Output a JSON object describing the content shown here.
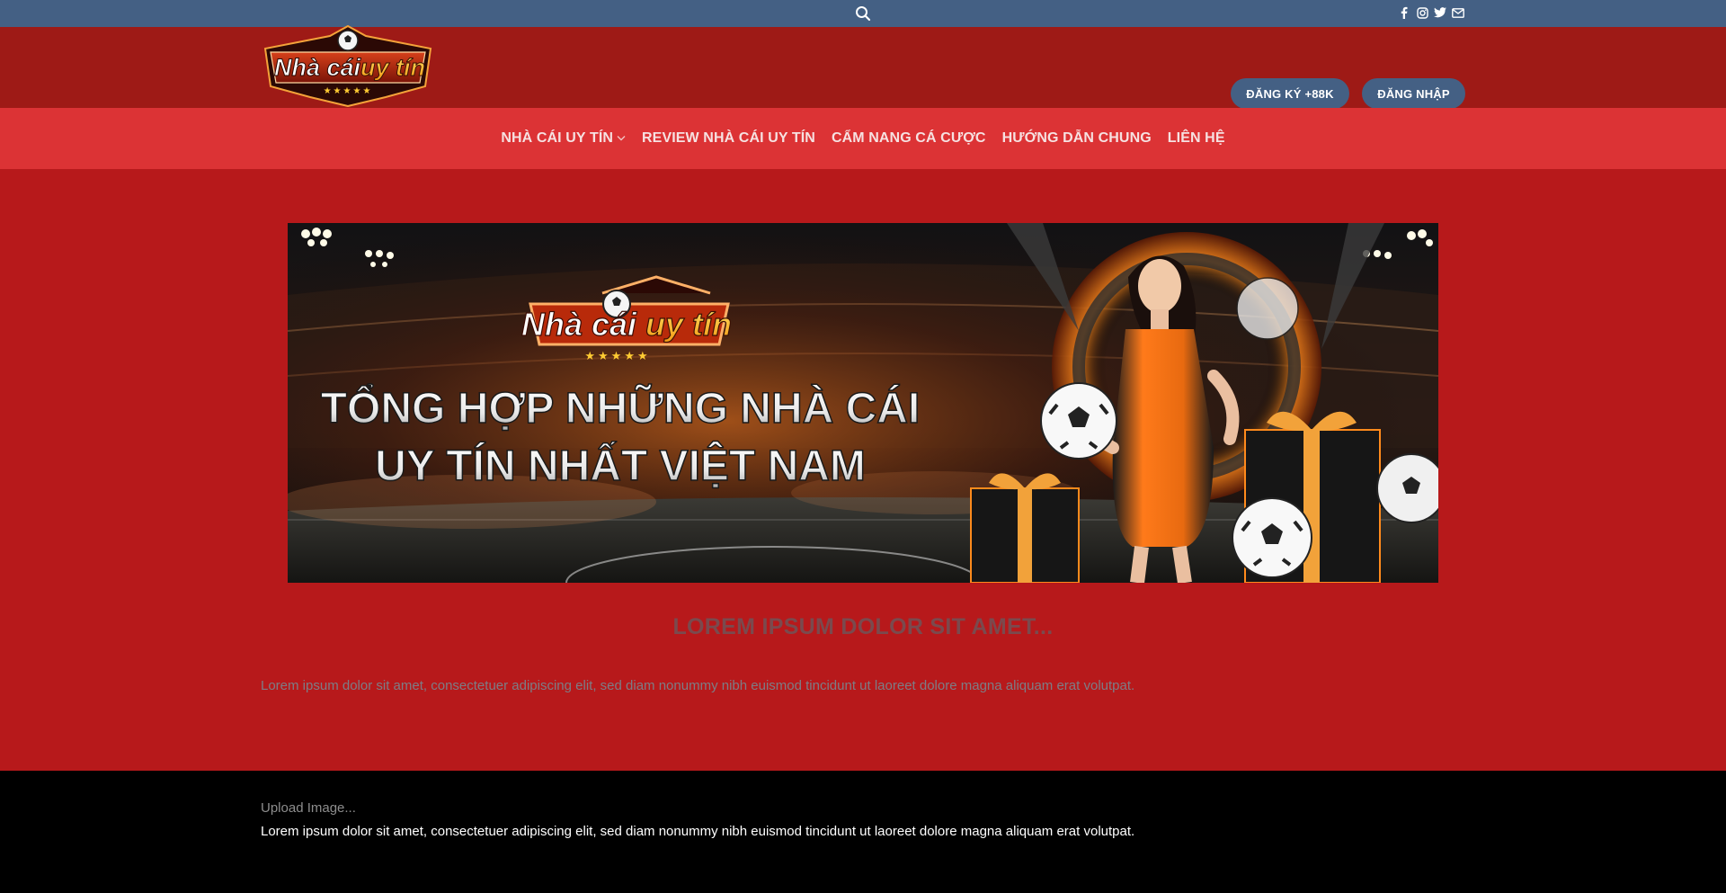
{
  "topbar": {
    "search_icon": "search-icon",
    "socials": [
      "facebook-icon",
      "instagram-icon",
      "twitter-icon",
      "email-icon"
    ]
  },
  "header": {
    "logo": {
      "line1": "Nhà cái",
      "line2": "uy tín",
      "stars": "★★★★★"
    },
    "register_label": "ĐĂNG KÝ +88K",
    "login_label": "ĐĂNG NHẬP"
  },
  "nav": {
    "items": [
      {
        "label": "NHÀ CÁI UY TÍN",
        "has_dropdown": true
      },
      {
        "label": "REVIEW NHÀ CÁI UY TÍN"
      },
      {
        "label": "CẨM NANG CÁ CƯỢC"
      },
      {
        "label": "HƯỚNG DẪN CHUNG"
      },
      {
        "label": "LIÊN HỆ"
      }
    ]
  },
  "banner": {
    "logo_line1": "Nhà cái",
    "logo_line2": "uy tín",
    "stars": "★★★★★",
    "headline_line1": "TỔNG HỢP NHỮNG NHÀ CÁI",
    "headline_line2": "UY TÍN NHẤT VIỆT NAM"
  },
  "main": {
    "heading": "LOREM IPSUM DOLOR SIT AMET...",
    "body": "Lorem ipsum dolor sit amet, consectetuer adipiscing elit, sed diam nonummy nibh euismod tincidunt ut laoreet dolore magna aliquam erat volutpat."
  },
  "footer": {
    "upload": "Upload Image...",
    "text": "Lorem ipsum dolor sit amet, consectetuer adipiscing elit, sed diam nonummy nibh euismod tincidunt ut laoreet dolore magna aliquam erat volutpat."
  },
  "colors": {
    "topbar": "#446084",
    "header": "#9e1a16",
    "nav": "#dc3335",
    "main": "#b7191b",
    "footer": "#000000",
    "button": "#446084",
    "accent_orange": "#ff8a1c"
  }
}
